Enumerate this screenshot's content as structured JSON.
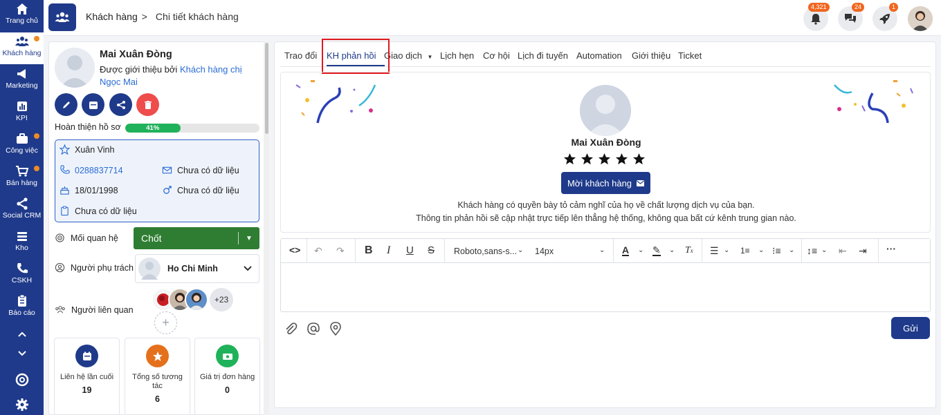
{
  "nav": {
    "items": [
      {
        "label": "Trang chủ",
        "icon": "home-icon",
        "active": false,
        "dot": false
      },
      {
        "label": "Khách hàng",
        "icon": "users-icon",
        "active": true,
        "dot": true
      },
      {
        "label": "Marketing",
        "icon": "megaphone-icon",
        "active": false,
        "dot": false
      },
      {
        "label": "KPI",
        "icon": "chart-icon",
        "active": false,
        "dot": false
      },
      {
        "label": "Công việc",
        "icon": "briefcase-icon",
        "active": false,
        "dot": true
      },
      {
        "label": "Bán hàng",
        "icon": "cart-icon",
        "active": false,
        "dot": true
      },
      {
        "label": "Social CRM",
        "icon": "share-icon",
        "active": false,
        "dot": false
      },
      {
        "label": "Kho",
        "icon": "stack-icon",
        "active": false,
        "dot": false
      },
      {
        "label": "CSKH",
        "icon": "phone-icon",
        "active": false,
        "dot": false
      },
      {
        "label": "Báo cáo",
        "icon": "clipboard-icon",
        "active": false,
        "dot": false
      }
    ]
  },
  "breadcrumb": {
    "parent": "Khách hàng",
    "separator": ">",
    "current": "Chi tiết khách hàng"
  },
  "topbar": {
    "notifications": "4,321",
    "messages": "24",
    "rocket": "1"
  },
  "customer": {
    "name": "Mai Xuân Đòng",
    "referred_prefix": "Được giới thiệu bởi",
    "referred_by": "Khách hàng chị Ngọc Mai",
    "progress_label": "Hoàn thiện hồ sơ",
    "progress_percent": 41,
    "progress_text": "41%",
    "source": "Xuân Vinh",
    "phone": "0288837714",
    "email": "Chưa có dữ liệu",
    "birthday": "18/01/1998",
    "gender": "Chưa có dữ liệu",
    "note": "Chưa có dữ liệu"
  },
  "relation": {
    "label": "Mối quan hệ",
    "value": "Chốt",
    "color": "#2e7d32"
  },
  "owner": {
    "label": "Người phụ trách",
    "value": "Ho Chi Minh"
  },
  "related": {
    "label": "Người liên quan",
    "more": "+23"
  },
  "stats": [
    {
      "title": "Liên hệ lần cuối",
      "value": "19",
      "color": "#1f3a8a",
      "icon": "calendar-icon"
    },
    {
      "title": "Tổng số tương tác",
      "value": "6",
      "color": "#e5701b",
      "icon": "star-icon"
    },
    {
      "title": "Giá trị đơn hàng",
      "value": "0",
      "color": "#20b25a",
      "icon": "money-icon"
    }
  ],
  "tabs": [
    "Trao đổi",
    "KH phản hồi",
    "Giao dịch",
    "Lịch hẹn",
    "Cơ hội",
    "Lịch đi tuyến",
    "Automation",
    "Giới thiệu",
    "Ticket"
  ],
  "active_tab": "KH phản hồi",
  "feedback": {
    "name": "Mai Xuân Đòng",
    "rating": 5,
    "invite_label": "Mời khách hàng",
    "line1": "Khách hàng có quyền bày tỏ cảm nghĩ của họ về chất lượng dịch vụ của bạn.",
    "line2": "Thông tin phản hồi sẽ cập nhật trực tiếp lên thẳng hệ thống, không qua bất cứ kênh trung gian nào."
  },
  "editor": {
    "font": "Roboto,sans-s...",
    "size": "14px"
  },
  "send_label": "Gửi",
  "colors": {
    "primary": "#1f3a8a",
    "accent": "#f08a24",
    "highlight": "#e0191e"
  }
}
